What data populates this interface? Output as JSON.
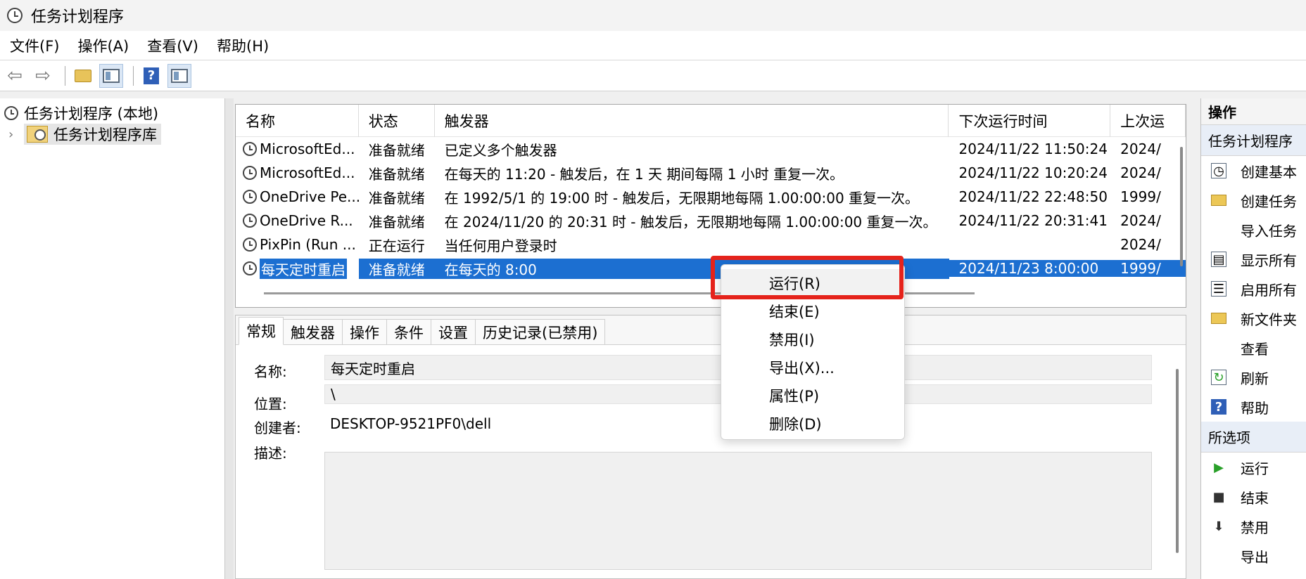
{
  "window": {
    "title": "任务计划程序"
  },
  "menubar": [
    "文件(F)",
    "操作(A)",
    "查看(V)",
    "帮助(H)"
  ],
  "tree": {
    "root": "任务计划程序 (本地)",
    "child": "任务计划程序库"
  },
  "tasklist": {
    "columns": [
      "名称",
      "状态",
      "触发器",
      "下次运行时间",
      "上次运"
    ],
    "rows": [
      {
        "name": "MicrosoftEd...",
        "status": "准备就绪",
        "trigger": "已定义多个触发器",
        "next": "2024/11/22 11:50:24",
        "last": "2024/"
      },
      {
        "name": "MicrosoftEd...",
        "status": "准备就绪",
        "trigger": "在每天的 11:20 - 触发后，在 1 天 期间每隔 1 小时 重复一次。",
        "next": "2024/11/22 10:20:24",
        "last": "2024/"
      },
      {
        "name": "OneDrive Pe...",
        "status": "准备就绪",
        "trigger": "在 1992/5/1 的 19:00 时 - 触发后，无限期地每隔 1.00:00:00 重复一次。",
        "next": "2024/11/22 22:48:50",
        "last": "1999/"
      },
      {
        "name": "OneDrive R...",
        "status": "准备就绪",
        "trigger": "在 2024/11/20 的 20:31 时 - 触发后，无限期地每隔 1.00:00:00 重复一次。",
        "next": "2024/11/22 20:31:41",
        "last": "2024/"
      },
      {
        "name": "PixPin (Run ...",
        "status": "正在运行",
        "trigger": "当任何用户登录时",
        "next": "",
        "last": "2024/"
      },
      {
        "name": "每天定时重启",
        "status": "准备就绪",
        "trigger": "在每天的 8:00",
        "next": "2024/11/23 8:00:00",
        "last": "1999/"
      }
    ]
  },
  "details": {
    "tabs": [
      "常规",
      "触发器",
      "操作",
      "条件",
      "设置",
      "历史记录(已禁用)"
    ],
    "name_label": "名称:",
    "name_value": "每天定时重启",
    "location_label": "位置:",
    "location_value": "\\",
    "author_label": "创建者:",
    "author_value": "DESKTOP-9521PF0\\dell",
    "desc_label": "描述:"
  },
  "context_menu": [
    "运行(R)",
    "结束(E)",
    "禁用(I)",
    "导出(X)...",
    "属性(P)",
    "删除(D)"
  ],
  "actions": {
    "header": "操作",
    "section1": "任务计划程序",
    "items1": [
      "创建基本",
      "创建任务",
      "导入任务",
      "显示所有",
      "启用所有",
      "新文件夹",
      "查看",
      "刷新",
      "帮助"
    ],
    "section2": "所选项",
    "items2": [
      "运行",
      "结束",
      "禁用",
      "导出"
    ]
  },
  "colors": {
    "selection": "#1c6fd1",
    "highlight_border": "#e5231b"
  }
}
